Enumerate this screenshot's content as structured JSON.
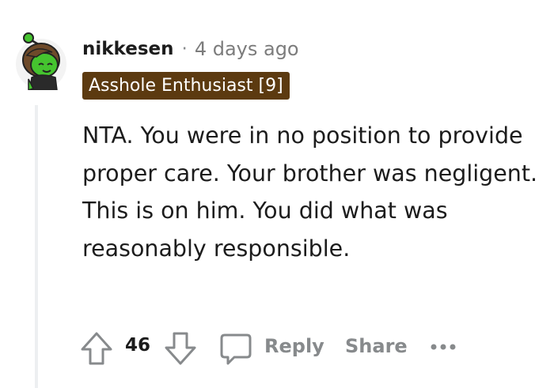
{
  "comment": {
    "username": "nikkesen",
    "separator": "·",
    "timestamp": "4 days ago",
    "flair": "Asshole Enthusiast [9]",
    "body": "NTA. You were in no position to provide proper care. Your brother was negligent. This is on him. You did what was reasonably responsible.",
    "score": "46"
  },
  "actions": {
    "reply_label": "Reply",
    "share_label": "Share"
  },
  "icons": {
    "upvote": "arrow-up-icon",
    "downvote": "arrow-down-icon",
    "comment": "speech-bubble-icon",
    "more": "more-horizontal-icon"
  },
  "colors": {
    "flair_background": "#5c3a10",
    "flair_text": "#ffffff",
    "avatar_skin": "#45c42f",
    "avatar_hair": "#6e4a2a",
    "muted_text": "#878a8c"
  }
}
